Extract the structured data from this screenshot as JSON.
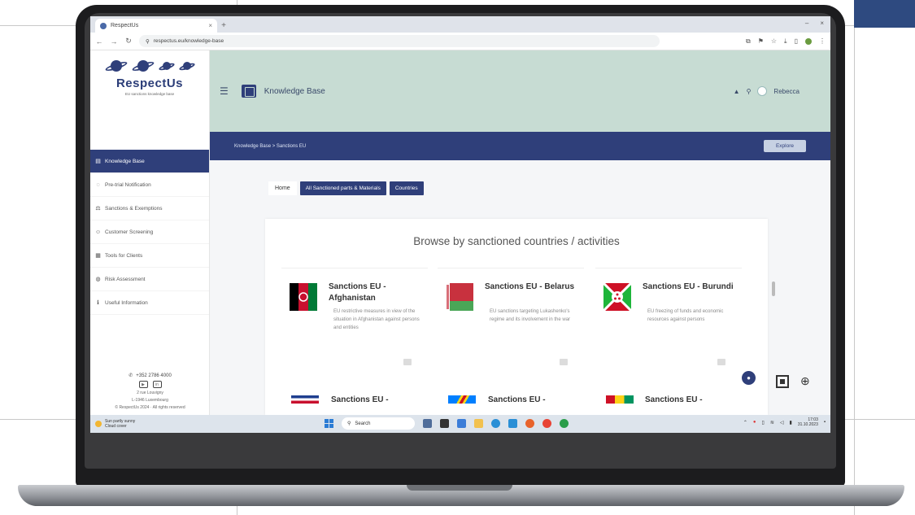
{
  "browser": {
    "tab_title": "RespectUs",
    "url": "respectus.eu/knowledge-base"
  },
  "brand": {
    "name": "RespectUs",
    "tagline": "EU sanctions knowledge base"
  },
  "sidebar": {
    "items": [
      {
        "label": "Knowledge Base",
        "icon": "book-icon",
        "active": true
      },
      {
        "label": "Pre-trial Notification",
        "icon": "bell-icon",
        "active": false
      },
      {
        "label": "Sanctions & Exemptions",
        "icon": "scale-icon",
        "active": false
      },
      {
        "label": "Customer Screening",
        "icon": "user-check-icon",
        "active": false
      },
      {
        "label": "Tools for Clients",
        "icon": "tools-icon",
        "active": false
      },
      {
        "label": "Risk Assessment",
        "icon": "chart-icon",
        "active": false
      },
      {
        "label": "Useful Information",
        "icon": "info-icon",
        "active": false
      }
    ],
    "contact": {
      "phone": "+352 2786 4000",
      "address_line1": "2 rue Louvigny",
      "address_line2": "L-1946 Luxembourg",
      "copyright": "© RespectUs 2024 · All rights reserved"
    }
  },
  "header": {
    "title": "Knowledge Base",
    "user": "Rebecca"
  },
  "breadcrumb": {
    "text": "Knowledge Base > Sanctions EU",
    "button_label": "Explore"
  },
  "filters": {
    "home": "Home",
    "active_filter": "All Sanctioned parts & Materials",
    "second_filter": "Countries"
  },
  "panel": {
    "title": "Browse by sanctioned countries / activities"
  },
  "cards": [
    {
      "title": "Sanctions EU - Afghanistan",
      "desc": "EU restrictive measures in view of the situation in Afghanistan against persons and entities",
      "flag": "afghanistan"
    },
    {
      "title": "Sanctions EU - Belarus",
      "desc": "EU sanctions targeting Lukashenko's regime and its involvement in the war",
      "flag": "belarus"
    },
    {
      "title": "Sanctions EU - Burundi",
      "desc": "EU freezing of funds and economic resources against persons",
      "flag": "burundi"
    }
  ],
  "cards_row2": [
    {
      "title": "Sanctions EU -"
    },
    {
      "title": "Sanctions EU -"
    },
    {
      "title": "Sanctions EU -"
    }
  ],
  "taskbar": {
    "weather_temp": "Sun partly sunny",
    "weather_desc": "Cloud cover",
    "search_placeholder": "Search",
    "time": "17:03",
    "date": "31.10.2023"
  },
  "colors": {
    "primary": "#2f3f7a",
    "header_bg": "#c7dcd3",
    "corner_accent": "#2e4a80"
  }
}
